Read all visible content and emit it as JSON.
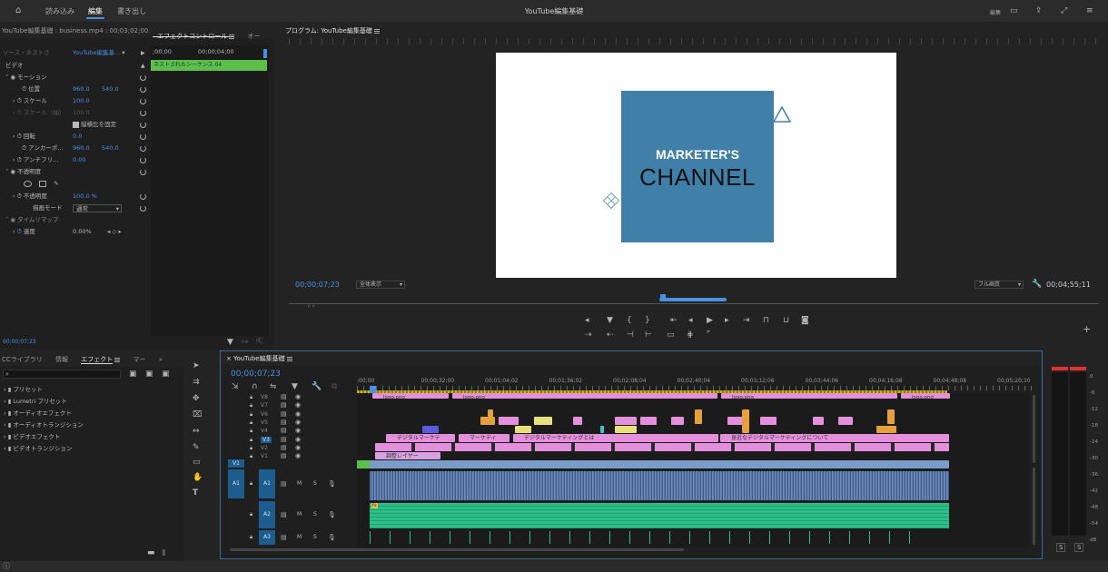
{
  "header": {
    "tabs": [
      "読み込み",
      "編集",
      "書き出し"
    ],
    "active_tab": "編集",
    "title": "YouTube編集基礎",
    "workspace_label": "編集"
  },
  "source_panel": {
    "clip_info": "YouTube編集基礎 : business.mp4 : 00;03;02;00",
    "tabs": [
      "エフェクトコントロール",
      "オー"
    ],
    "sub_source": "ソース・ネストさ",
    "sub_sequence": "YouTube編集基...",
    "mini_time_start": ";00;00",
    "mini_time_end": "00;00;04;00",
    "nested_clip": "ネストされたシーケンス 04",
    "section_video": "ビデオ",
    "fx_motion": "モーション",
    "position_label": "位置",
    "position_x": "960.0",
    "position_y": "540.0",
    "scale_label": "スケール",
    "scale_value": "100.0",
    "scale_w_label": "スケール（幅）",
    "scale_w_value": "100.0",
    "uniform_scale": "縦横比を固定",
    "rotation_label": "回転",
    "rotation_value": "0.0",
    "anchor_label": "アンカーポ...",
    "anchor_x": "960.0",
    "anchor_y": "540.0",
    "antiflicker_label": "アンチフリ...",
    "antiflicker_value": "0.00",
    "fx_opacity": "不透明度",
    "opacity_label": "不透明度",
    "opacity_value": "100.0 %",
    "blend_label": "描画モード",
    "blend_value": "通常",
    "fx_timeremap": "タイムリマップ",
    "speed_label": "速度",
    "speed_value": "0.00%",
    "footer_time": "00;00;07;23"
  },
  "program_monitor": {
    "title": "プログラム: YouTube編集基礎",
    "logo_line1": "MARKETER'S",
    "logo_line2": "CHANNEL",
    "timecode": "00;00;07;23",
    "fit_label": "全体表示",
    "quality_label": "フル画質",
    "duration": "00;04;55;11"
  },
  "effects_panel": {
    "tabs": [
      "CCライブラリ",
      "情報",
      "エフェクト",
      "マー"
    ],
    "active_tab": "エフェクト",
    "items": [
      "プリセット",
      "Lumetri プリセット",
      "オーディオエフェクト",
      "オーディオトランジション",
      "ビデオエフェクト",
      "ビデオトランジション"
    ]
  },
  "timeline": {
    "tab": "YouTube編集基礎",
    "timecode": "00;00;07;23",
    "ruler": [
      ":00;00",
      "00;00;32;00",
      "00;01;04;02",
      "00;01;36;02",
      "00;02;08;04",
      "00;02;40;04",
      "00;03;12;06",
      "00;03;44;06",
      "00;04;16;08",
      "00;04;48;08",
      "00;05;20;10"
    ],
    "video_tracks": [
      "V8",
      "V7",
      "V6",
      "V5",
      "V4",
      "V3",
      "V2",
      "V1"
    ],
    "audio_tracks": [
      "A1",
      "A2",
      "A3"
    ],
    "source_v1": "V1",
    "source_a1": "A1",
    "clip_logo": "logo.png",
    "clip_fx": "fx",
    "clip_digital1": "デジタルマーケテ",
    "clip_digital2": "マーケティ",
    "clip_digital3": "デジタルマーケティングとは",
    "clip_digital4": "身近なデジタルマーケティングについて",
    "clip_adjust": "調整レイヤー",
    "m_label": "M",
    "s_label": "S"
  },
  "meter": {
    "scale": [
      "0",
      "-6",
      "-12",
      "-18",
      "-24",
      "-30",
      "-36",
      "-42",
      "-48",
      "-54",
      "dB"
    ],
    "solo_labels": [
      "S",
      "S"
    ]
  },
  "colors": {
    "accent": "#4a90e2",
    "clip_pink": "#e48fdc",
    "clip_orange": "#e6a13a",
    "audio_green": "#2dbf8a",
    "logo_blue": "#3f7fa8"
  }
}
